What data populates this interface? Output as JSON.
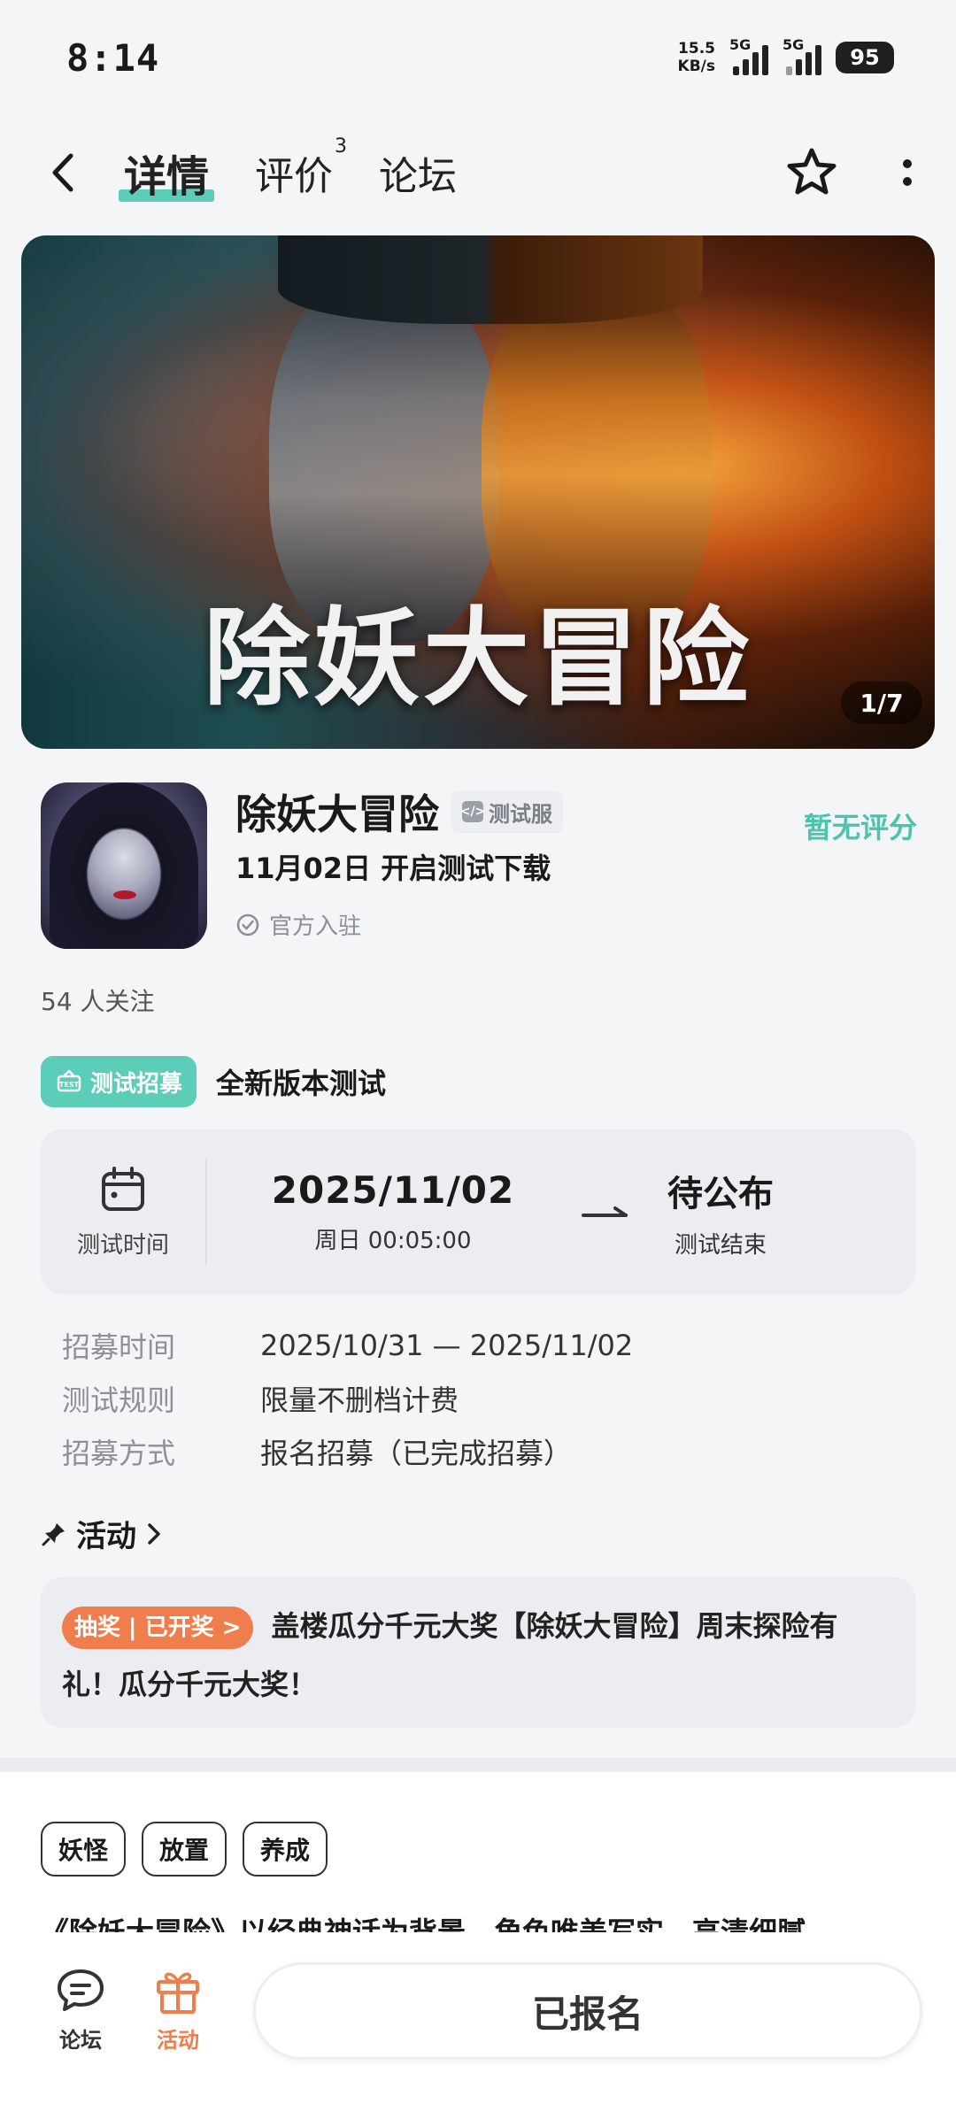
{
  "status_bar": {
    "time": "8:14",
    "net_speed_value": "15.5",
    "net_speed_unit": "KB/s",
    "signal1_label": "5G",
    "signal2_label": "5G",
    "battery": "95"
  },
  "nav": {
    "tabs": [
      {
        "label": "详情",
        "active": true
      },
      {
        "label": "评价",
        "badge": "3"
      },
      {
        "label": "论坛"
      }
    ]
  },
  "banner": {
    "title": "除妖大冒险",
    "counter": "1/7"
  },
  "game": {
    "title": "除妖大冒险",
    "badge": "测试服",
    "date_line": "11月02日 开启测试下载",
    "official": "官方入驻",
    "rating": "暂无评分",
    "followers": "54 人关注"
  },
  "recruit": {
    "badge": "测试招募",
    "title": "全新版本测试",
    "time_label": "测试时间",
    "start_date": "2025/11/02",
    "start_time": "周日  00:05:00",
    "end_status": "待公布",
    "end_label": "测试结束",
    "details": [
      {
        "key": "招募时间",
        "value": "2025/10/31 — 2025/11/02"
      },
      {
        "key": "测试规则",
        "value": "限量不删档计费"
      },
      {
        "key": "招募方式",
        "value": "报名招募（已完成招募）"
      }
    ]
  },
  "activity": {
    "heading": "活动",
    "badge": "抽奖 | 已开奖 >",
    "text": "盖楼瓜分千元大奖【除妖大冒险】周末探险有礼！瓜分千元大奖！"
  },
  "tags": [
    "妖怪",
    "放置",
    "养成"
  ],
  "description": "《除妖大冒险》以经典神话为背景，角色唯美写实，高清细腻，",
  "bottom": {
    "forum_label": "论坛",
    "activity_label": "活动",
    "signup_label": "已报名"
  },
  "colors": {
    "accent_teal": "#5ccdb9",
    "accent_orange": "#f07e4c"
  }
}
